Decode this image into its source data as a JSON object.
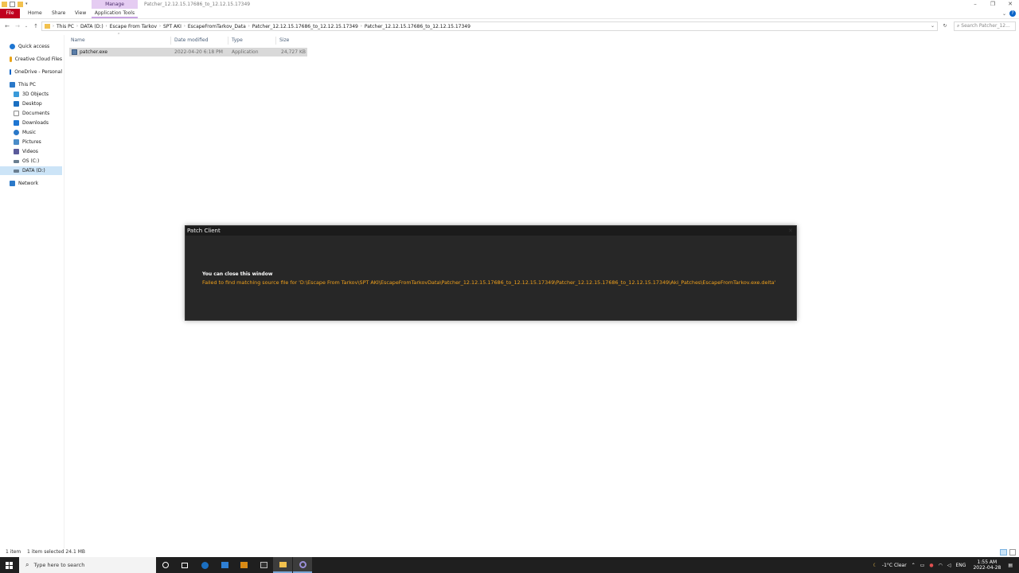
{
  "window": {
    "title": "Patcher_12.12.15.17686_to_12.12.15.17349",
    "manage_tab": "Manage",
    "controls": {
      "minimize": "–",
      "restore": "❐",
      "close": "✕"
    }
  },
  "ribbon": {
    "tabs": [
      "File",
      "Home",
      "Share",
      "View",
      "Application Tools"
    ],
    "help": "?"
  },
  "address": {
    "crumbs": [
      "This PC",
      "DATA (D:)",
      "Escape From Tarkov",
      "SPT AKI",
      "EscapeFromTarkov_Data",
      "Patcher_12.12.15.17686_to_12.12.15.17349",
      "Patcher_12.12.15.17686_to_12.12.15.17349"
    ],
    "search_placeholder": "Search Patcher_12..."
  },
  "sidebar": {
    "items": [
      {
        "label": "Quick access",
        "icon": "star-icon",
        "color": "#1e76d2"
      },
      {
        "label": "Creative Cloud Files",
        "icon": "cloud-icon",
        "color": "#e8a317"
      },
      {
        "label": "OneDrive - Personal",
        "icon": "onedrive-icon",
        "color": "#0a64c8"
      },
      {
        "label": "This PC",
        "icon": "computer-icon",
        "color": "#2a78c8"
      },
      {
        "label": "3D Objects",
        "icon": "cube-icon",
        "color": "#3a9ad9"
      },
      {
        "label": "Desktop",
        "icon": "desktop-icon",
        "color": "#1b6fc1"
      },
      {
        "label": "Documents",
        "icon": "document-icon",
        "color": "#8c8c8c"
      },
      {
        "label": "Downloads",
        "icon": "download-icon",
        "color": "#1e76d2"
      },
      {
        "label": "Music",
        "icon": "music-icon",
        "color": "#2a78c8"
      },
      {
        "label": "Pictures",
        "icon": "picture-icon",
        "color": "#4a8cc8"
      },
      {
        "label": "Videos",
        "icon": "video-icon",
        "color": "#5a5a9a"
      },
      {
        "label": "OS (C:)",
        "icon": "drive-icon",
        "color": "#6a7e90"
      },
      {
        "label": "DATA (D:)",
        "icon": "drive-icon",
        "color": "#6a7e90"
      },
      {
        "label": "Network",
        "icon": "network-icon",
        "color": "#2a78c8"
      }
    ]
  },
  "filelist": {
    "columns": [
      "Name",
      "Date modified",
      "Type",
      "Size"
    ],
    "rows": [
      {
        "name": "patcher.exe",
        "date": "2022-04-20 6:18 PM",
        "type": "Application",
        "size": "24,727 KB"
      }
    ]
  },
  "status": {
    "count": "1 item",
    "selected": "1 item selected  24.1 MB"
  },
  "dialog": {
    "title": "Patch Client",
    "heading": "You can close this window",
    "error": "Failed to find matching source file for 'D:\\Escape From Tarkov\\SPT AKI\\EscapeFromTarkovData\\Patcher_12.12.15.17686_to_12.12.15.17349\\Patcher_12.12.15.17686_to_12.12.15.17349\\Aki_Patches\\EscapeFromTarkov.exe.delta'",
    "close": "✕"
  },
  "taskbar": {
    "search_placeholder": "Type here to search",
    "weather": "-1°C  Clear",
    "lang": "ENG",
    "time": "1:55 AM",
    "date": "2022-04-28"
  },
  "colors": {
    "file_tab": "#c0001f",
    "manage_tab": "#e5ccf2",
    "dialog_bg": "#272727",
    "error_text": "#f1a11b"
  }
}
